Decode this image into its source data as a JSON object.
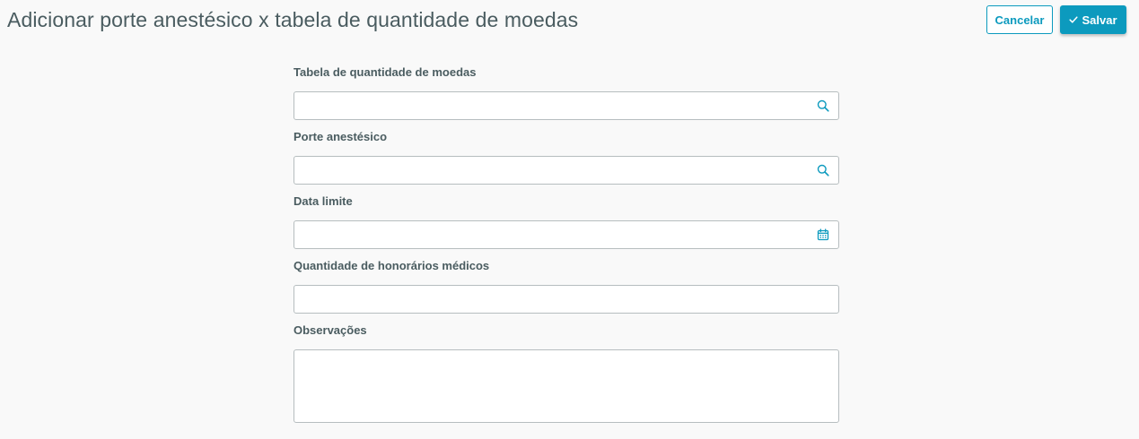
{
  "header": {
    "title": "Adicionar porte anestésico x tabela de quantidade de moedas",
    "cancel_label": "Cancelar",
    "save_label": "Salvar"
  },
  "form": {
    "fields": [
      {
        "label": "Tabela de quantidade de moedas",
        "value": "",
        "placeholder": "",
        "icon": "search-icon"
      },
      {
        "label": "Porte anestésico",
        "value": "",
        "placeholder": "",
        "icon": "search-icon"
      },
      {
        "label": "Data limite",
        "value": "",
        "placeholder": "",
        "icon": "calendar-icon"
      },
      {
        "label": "Quantidade de honorários médicos",
        "value": "",
        "placeholder": ""
      },
      {
        "label": "Observações",
        "value": "",
        "placeholder": ""
      }
    ]
  },
  "colors": {
    "accent": "#0c9abe",
    "text": "#4a5c60",
    "border": "#b6bdbf",
    "background": "#f9f9f9"
  }
}
